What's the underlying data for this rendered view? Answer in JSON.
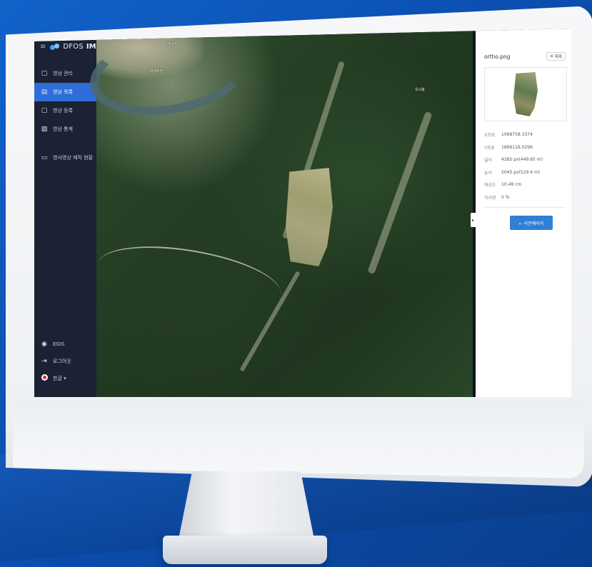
{
  "sidebar": {
    "menu_icon": "≡",
    "brand_name": "DFOS",
    "brand_suffix": "IMS",
    "items": [
      {
        "label": "영상 관리",
        "icon": "▢",
        "icon_name": "document-icon"
      },
      {
        "label": "영상 목록",
        "icon": "▤",
        "icon_name": "list-icon",
        "active": true
      },
      {
        "label": "영상 등록",
        "icon": "▢",
        "icon_name": "upload-icon"
      },
      {
        "label": "영상 통계",
        "icon": "▨",
        "icon_name": "stats-icon"
      },
      {
        "label": "영사영상 제작 현황",
        "icon": "▭",
        "icon_name": "monitor-icon"
      }
    ],
    "bottom": {
      "user_label": "EGIS",
      "logout_label": "로그아웃",
      "lang_label": "한글 ▾"
    }
  },
  "map": {
    "top_label": "명승지",
    "village_label": "하회마을",
    "peak_label": "옥녀봉"
  },
  "panel": {
    "toggle_arrow": "▸",
    "file_name": "ortho.png",
    "list_button_icon": "≡",
    "list_button_label": "목록",
    "meta": [
      {
        "key": "X좌표",
        "value": "1068758.3374"
      },
      {
        "key": "Y좌표",
        "value": "1899116.0296"
      },
      {
        "key": "넓이",
        "value": "4285 px(449.65 m)"
      },
      {
        "key": "높이",
        "value": "5045 px(529.4 m)"
      },
      {
        "key": "해상도",
        "value": "10.48 cm"
      },
      {
        "key": "처리량",
        "value": "0 %"
      }
    ],
    "back_button_label": "← 이전페이지"
  },
  "colors": {
    "sidebar_bg": "#1b2234",
    "active_item": "#2f6dd8",
    "button_blue": "#2f7fd6",
    "page_bg": "#1262c9"
  }
}
